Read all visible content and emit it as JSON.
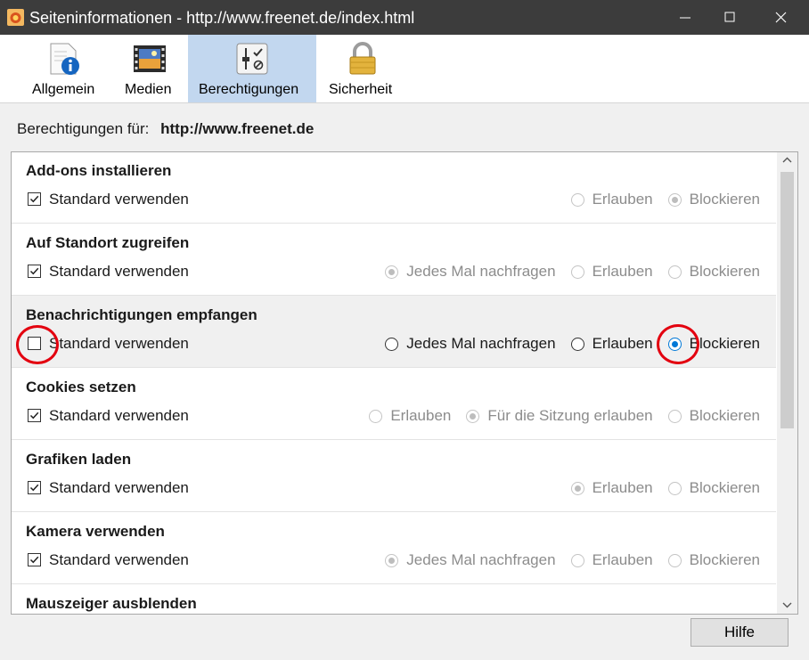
{
  "window": {
    "title": "Seiteninformationen - http://www.freenet.de/index.html"
  },
  "toolbar": {
    "tabs": [
      {
        "label": "Allgemein",
        "icon": "info-icon",
        "selected": false
      },
      {
        "label": "Medien",
        "icon": "media-icon",
        "selected": false
      },
      {
        "label": "Berechtigungen",
        "icon": "permissions-icon",
        "selected": true
      },
      {
        "label": "Sicherheit",
        "icon": "lock-icon",
        "selected": false
      }
    ]
  },
  "permissions": {
    "for_label": "Berechtigungen für:",
    "site": "http://www.freenet.de",
    "default_label": "Standard verwenden",
    "rows": [
      {
        "title": "Add-ons installieren",
        "use_default": true,
        "options": [
          "Erlauben",
          "Blockieren"
        ],
        "selected": "Blockieren"
      },
      {
        "title": "Auf Standort zugreifen",
        "use_default": true,
        "options": [
          "Jedes Mal nachfragen",
          "Erlauben",
          "Blockieren"
        ],
        "selected": "Jedes Mal nachfragen"
      },
      {
        "title": "Benachrichtigungen empfangen",
        "use_default": false,
        "options": [
          "Jedes Mal nachfragen",
          "Erlauben",
          "Blockieren"
        ],
        "selected": "Blockieren"
      },
      {
        "title": "Cookies setzen",
        "use_default": true,
        "options": [
          "Erlauben",
          "Für die Sitzung erlauben",
          "Blockieren"
        ],
        "selected": "Für die Sitzung erlauben"
      },
      {
        "title": "Grafiken laden",
        "use_default": true,
        "options": [
          "Erlauben",
          "Blockieren"
        ],
        "selected": "Erlauben"
      },
      {
        "title": "Kamera verwenden",
        "use_default": true,
        "options": [
          "Jedes Mal nachfragen",
          "Erlauben",
          "Blockieren"
        ],
        "selected": "Jedes Mal nachfragen"
      },
      {
        "title": "Mauszeiger ausblenden"
      }
    ]
  },
  "footer": {
    "help_label": "Hilfe"
  },
  "colors": {
    "titlebar": "#3c3c3c",
    "selected_tab": "#c2d7ef",
    "accent": "#0078d7",
    "annotation": "#e3000f"
  }
}
